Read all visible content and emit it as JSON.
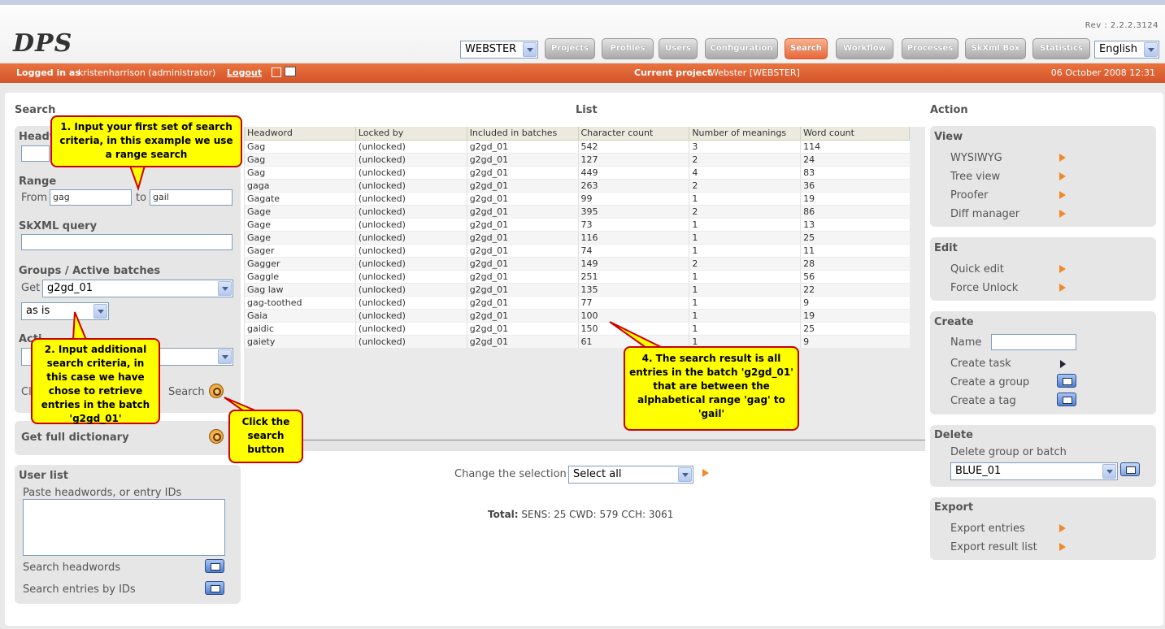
{
  "app": {
    "logo": "DPS",
    "rev": "Rev : 2.2.2.3124"
  },
  "header": {
    "project_select": "WEBSTER",
    "language_select": "English",
    "nav": [
      "Projects",
      "Profiles",
      "Users",
      "Configuration",
      "Search",
      "Workflow",
      "Processes",
      "SkXml Box",
      "Statistics"
    ],
    "active_nav": "Search"
  },
  "status": {
    "logged_in_label": "Logged in as",
    "user": "kristenharrison (administrator)",
    "logout": "Logout",
    "current_project_label": "Current project",
    "current_project": "Webster [WEBSTER]",
    "date": "06 October 2008 12:31"
  },
  "search": {
    "title": "Search",
    "headword_label": "Headw",
    "range_label": "Range",
    "from_label": "From",
    "from_value": "gag",
    "to_label": "to",
    "to_value": "gail",
    "skxml_label": "SkXML query",
    "groups_label": "Groups / Active batches",
    "get_label": "Get",
    "batch_value": "g2gd_01",
    "mode_value": "as is",
    "actions_label": "Acti",
    "clear_label": "Cl",
    "search_label": "Search",
    "full_dict_label": "Get full dictionary"
  },
  "userlist": {
    "title": "User list",
    "paste_label": "Paste headwords, or entry IDs",
    "search_headwords": "Search headwords",
    "search_ids": "Search entries by IDs"
  },
  "list": {
    "title": "List",
    "columns": [
      "Headword",
      "Locked by",
      "Included in batches",
      "Character count",
      "Number of meanings",
      "Word count"
    ],
    "rows": [
      [
        "Gag",
        "(unlocked)",
        "g2gd_01",
        "542",
        "3",
        "114"
      ],
      [
        "Gag",
        "(unlocked)",
        "g2gd_01",
        "127",
        "2",
        "24"
      ],
      [
        "Gag",
        "(unlocked)",
        "g2gd_01",
        "449",
        "4",
        "83"
      ],
      [
        "gaga",
        "(unlocked)",
        "g2gd_01",
        "263",
        "2",
        "36"
      ],
      [
        "Gagate",
        "(unlocked)",
        "g2gd_01",
        "99",
        "1",
        "19"
      ],
      [
        "Gage",
        "(unlocked)",
        "g2gd_01",
        "395",
        "2",
        "86"
      ],
      [
        "Gage",
        "(unlocked)",
        "g2gd_01",
        "73",
        "1",
        "13"
      ],
      [
        "Gage",
        "(unlocked)",
        "g2gd_01",
        "116",
        "1",
        "25"
      ],
      [
        "Gager",
        "(unlocked)",
        "g2gd_01",
        "74",
        "1",
        "11"
      ],
      [
        "Gagger",
        "(unlocked)",
        "g2gd_01",
        "149",
        "2",
        "28"
      ],
      [
        "Gaggle",
        "(unlocked)",
        "g2gd_01",
        "251",
        "1",
        "56"
      ],
      [
        "Gag law",
        "(unlocked)",
        "g2gd_01",
        "135",
        "1",
        "22"
      ],
      [
        "gag-toothed",
        "(unlocked)",
        "g2gd_01",
        "77",
        "1",
        "9"
      ],
      [
        "Gaia",
        "(unlocked)",
        "g2gd_01",
        "100",
        "1",
        "19"
      ],
      [
        "gaidic",
        "(unlocked)",
        "g2gd_01",
        "150",
        "1",
        "25"
      ],
      [
        "gaiety",
        "(unlocked)",
        "g2gd_01",
        "61",
        "1",
        "9"
      ]
    ],
    "change_label": "Change the selection",
    "change_value": "Select all",
    "total_label": "Total:",
    "total_value": "SENS: 25 CWD: 579 CCH: 3061"
  },
  "action": {
    "title": "Action",
    "view": {
      "title": "View",
      "items": [
        "WYSIWYG",
        "Tree view",
        "Proofer",
        "Diff manager"
      ]
    },
    "edit": {
      "title": "Edit",
      "items": [
        "Quick edit",
        "Force Unlock"
      ]
    },
    "create": {
      "title": "Create",
      "name_label": "Name",
      "items": [
        "Create task",
        "Create a group",
        "Create a tag"
      ]
    },
    "delete": {
      "title": "Delete",
      "label": "Delete group or batch",
      "value": "BLUE_01"
    },
    "export": {
      "title": "Export",
      "items": [
        "Export entries",
        "Export result list"
      ]
    }
  },
  "callouts": {
    "c1": "1. Input your first set of search criteria, in this example we use a range search",
    "c2": "2. Input additional search criteria, in this case we have chose to retrieve entries in the batch 'g2gd_01'",
    "c3": "Click the search button",
    "c4": "4. The search result is all entries in the batch 'g2gd_01' that are between the alphabetical range 'gag' to 'gail'"
  }
}
